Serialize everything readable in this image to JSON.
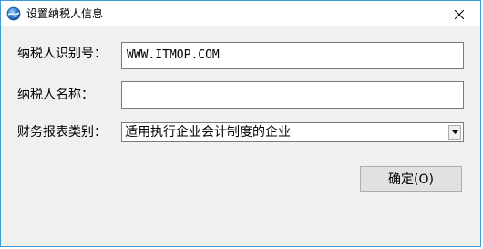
{
  "window": {
    "title": "设置纳税人信息",
    "title_icon": "blue-globe-icon",
    "close_icon": "close-icon"
  },
  "form": {
    "taxpayer_id_label": "纳税人识别号：",
    "taxpayer_id_value": "WWW.ITMOP.COM",
    "taxpayer_name_label": "纳税人名称：",
    "taxpayer_name_value": "",
    "report_type_label": "财务报表类别：",
    "report_type_value": "适用执行企业会计制度的企业"
  },
  "actions": {
    "ok_label": "确定(O)"
  },
  "colors": {
    "window_border": "#3c9ad8",
    "dialog_background": "#f0f0f0",
    "button_background": "#e1e1e1"
  }
}
